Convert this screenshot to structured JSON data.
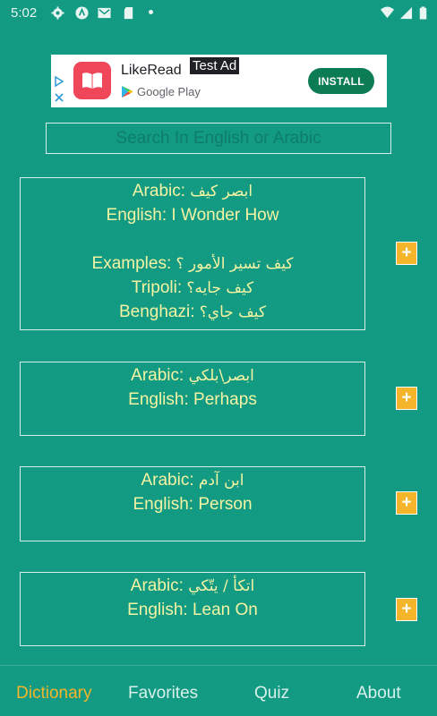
{
  "status_bar": {
    "time": "5:02",
    "icons": [
      "gear-icon",
      "app-icon",
      "mail-icon",
      "sd-card-icon",
      "dot-icon",
      "wifi-icon",
      "signal-icon",
      "battery-icon"
    ]
  },
  "ad": {
    "app_name": "LikeRead",
    "store": "Google Play",
    "badge": "Test Ad",
    "install_label": "INSTALL",
    "icons": [
      "adchoices-icon",
      "close-icon",
      "book-icon",
      "google-play-icon"
    ]
  },
  "search": {
    "placeholder": "Search In English or Arabic",
    "value": ""
  },
  "words": [
    {
      "arabic_label": "Arabic:",
      "arabic": "ابصر كيف",
      "english_label": "English:",
      "english": "I Wonder How",
      "examples_label": "Examples:",
      "examples": "كيف تسير الأمور ؟",
      "tripoli_label": "Tripoli:",
      "tripoli": "كيف جايه؟",
      "benghazi_label": "Benghazi:",
      "benghazi": "كيف جاي؟",
      "add_label": "+"
    },
    {
      "arabic_label": "Arabic:",
      "arabic": "ابصر\\بلكي",
      "english_label": "English:",
      "english": "Perhaps",
      "add_label": "+"
    },
    {
      "arabic_label": "Arabic:",
      "arabic": "ابن آدم",
      "english_label": "English:",
      "english": "Person",
      "add_label": "+"
    },
    {
      "arabic_label": "Arabic:",
      "arabic": "اتكأ / يتّكي",
      "english_label": "English:",
      "english": "Lean On",
      "add_label": "+"
    }
  ],
  "nav": {
    "tabs": [
      "Dictionary",
      "Favorites",
      "Quiz",
      "About"
    ],
    "active": "Dictionary"
  },
  "colors": {
    "background": "#129b82",
    "text": "#f4f3a3",
    "accent": "#f4b52b",
    "border": "#d8efe9"
  }
}
